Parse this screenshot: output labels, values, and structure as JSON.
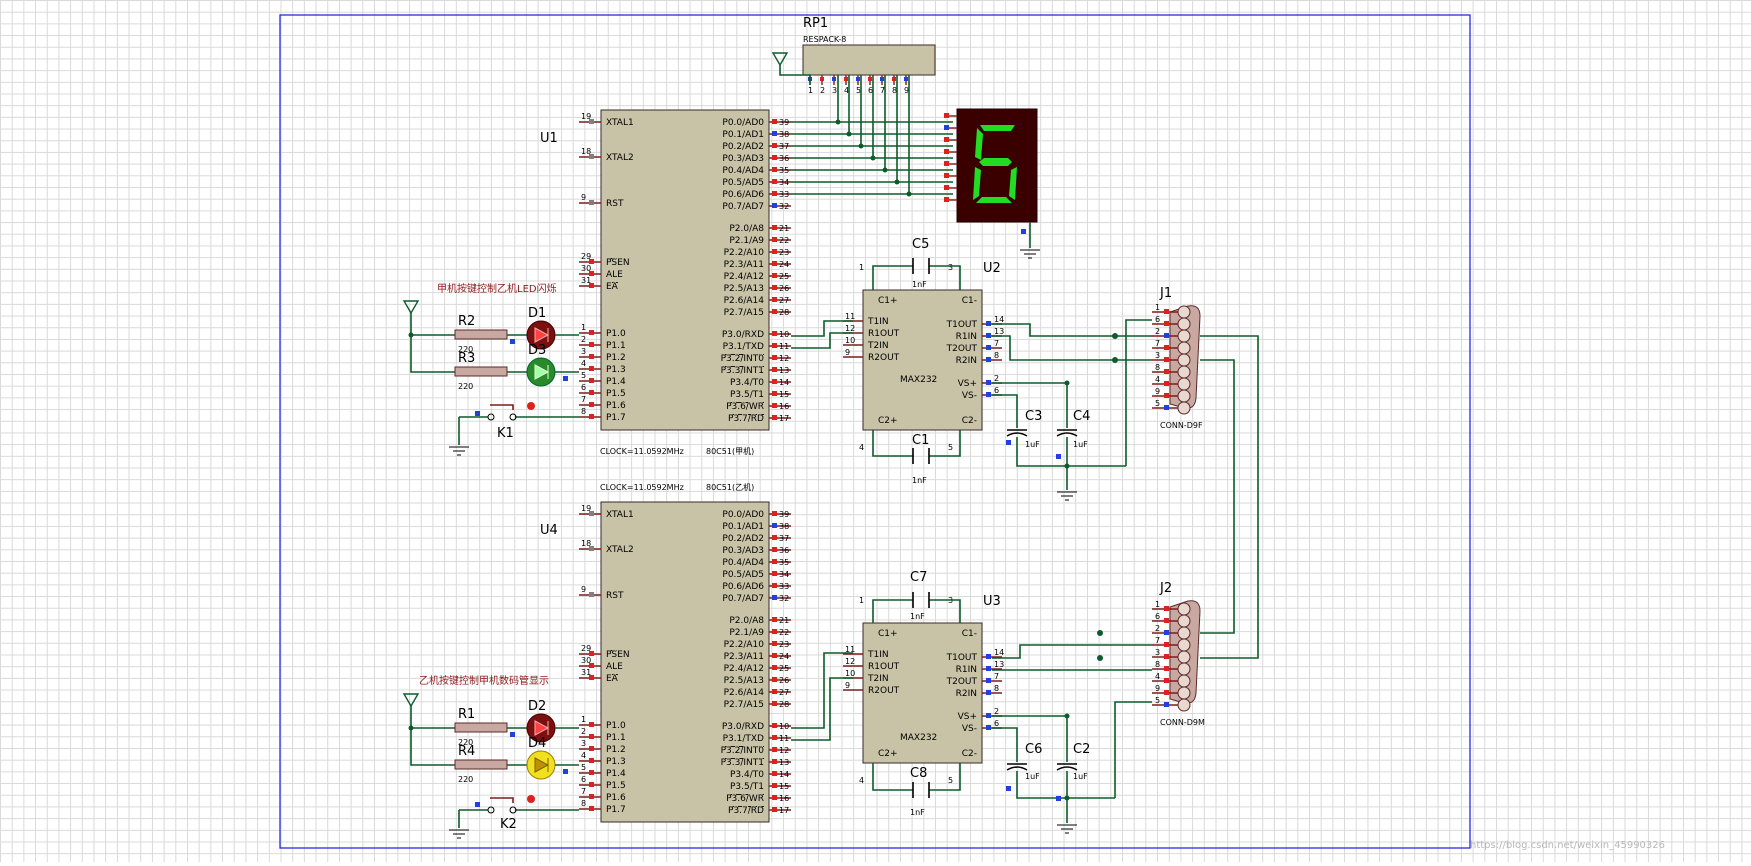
{
  "rp1": {
    "ref": "RP1",
    "value": "RESPACK-8"
  },
  "u1": {
    "ref": "U1",
    "type": "80C51(甲机)",
    "clock": "CLOCK=11.0592MHz"
  },
  "u4": {
    "ref": "U4",
    "type": "80C51(乙机)",
    "clock": "CLOCK=11.0592MHz"
  },
  "u2": {
    "ref": "U2",
    "type": "MAX232"
  },
  "u3": {
    "ref": "U3",
    "type": "MAX232"
  },
  "j1": {
    "ref": "J1",
    "type": "CONN-D9F"
  },
  "j2": {
    "ref": "J2",
    "type": "CONN-D9M"
  },
  "caps": {
    "c5": "C5",
    "c1": "C1",
    "c3": "C3",
    "c4": "C4",
    "c7": "C7",
    "c8": "C8",
    "c6": "C6",
    "c2": "C2",
    "val_1nf": "1nF",
    "val_1uf": "1uF"
  },
  "resistors": {
    "r2": "R2",
    "r3": "R3",
    "r1": "R1",
    "r4": "R4",
    "value": "220"
  },
  "leds": {
    "d1": "D1",
    "d3": "D3",
    "d2": "D2",
    "d4": "D4"
  },
  "keys": {
    "k1": "K1",
    "k2": "K2"
  },
  "notes": {
    "top": "甲机按键控制乙机LED闪烁",
    "bottom": "乙机按键控制甲机数码管显示"
  },
  "mcu_left_pins": [
    {
      "num": "19",
      "name": "XTAL1"
    },
    {
      "num": "18",
      "name": "XTAL2"
    },
    {
      "num": "9",
      "name": "RST"
    },
    {
      "num": "29",
      "name": "PSEN"
    },
    {
      "num": "30",
      "name": "ALE"
    },
    {
      "num": "31",
      "name": "EA"
    },
    {
      "num": "1",
      "name": "P1.0"
    },
    {
      "num": "2",
      "name": "P1.1"
    },
    {
      "num": "3",
      "name": "P1.2"
    },
    {
      "num": "4",
      "name": "P1.3"
    },
    {
      "num": "5",
      "name": "P1.4"
    },
    {
      "num": "6",
      "name": "P1.5"
    },
    {
      "num": "7",
      "name": "P1.6"
    },
    {
      "num": "8",
      "name": "P1.7"
    }
  ],
  "mcu_right_pins": [
    {
      "num": "39",
      "name": "P0.0/AD0"
    },
    {
      "num": "38",
      "name": "P0.1/AD1"
    },
    {
      "num": "37",
      "name": "P0.2/AD2"
    },
    {
      "num": "36",
      "name": "P0.3/AD3"
    },
    {
      "num": "35",
      "name": "P0.4/AD4"
    },
    {
      "num": "34",
      "name": "P0.5/AD5"
    },
    {
      "num": "33",
      "name": "P0.6/AD6"
    },
    {
      "num": "32",
      "name": "P0.7/AD7"
    },
    {
      "num": "21",
      "name": "P2.0/A8"
    },
    {
      "num": "22",
      "name": "P2.1/A9"
    },
    {
      "num": "23",
      "name": "P2.2/A10"
    },
    {
      "num": "24",
      "name": "P2.3/A11"
    },
    {
      "num": "25",
      "name": "P2.4/A12"
    },
    {
      "num": "26",
      "name": "P2.5/A13"
    },
    {
      "num": "27",
      "name": "P2.6/A14"
    },
    {
      "num": "28",
      "name": "P2.7/A15"
    },
    {
      "num": "10",
      "name": "P3.0/RXD"
    },
    {
      "num": "11",
      "name": "P3.1/TXD"
    },
    {
      "num": "12",
      "name": "P3.2/INT0"
    },
    {
      "num": "13",
      "name": "P3.3/INT1"
    },
    {
      "num": "14",
      "name": "P3.4/T0"
    },
    {
      "num": "15",
      "name": "P3.5/T1"
    },
    {
      "num": "16",
      "name": "P3.6/WR"
    },
    {
      "num": "17",
      "name": "P3.7/RD"
    }
  ],
  "max_left_pins": [
    {
      "num": "1",
      "name": "C1+"
    },
    {
      "num": "11",
      "name": "T1IN"
    },
    {
      "num": "12",
      "name": "R1OUT"
    },
    {
      "num": "10",
      "name": "T2IN"
    },
    {
      "num": "9",
      "name": "R2OUT"
    },
    {
      "num": "4",
      "name": "C2+"
    }
  ],
  "max_right_pins": [
    {
      "num": "3",
      "name": "C1-"
    },
    {
      "num": "14",
      "name": "T1OUT"
    },
    {
      "num": "13",
      "name": "R1IN"
    },
    {
      "num": "7",
      "name": "T2OUT"
    },
    {
      "num": "8",
      "name": "R2IN"
    },
    {
      "num": "2",
      "name": "VS+"
    },
    {
      "num": "6",
      "name": "VS-"
    },
    {
      "num": "5",
      "name": "C2-"
    }
  ],
  "db9_pins": [
    "1",
    "6",
    "2",
    "7",
    "3",
    "8",
    "4",
    "9",
    "5"
  ],
  "rp_pins": [
    "1",
    "2",
    "3",
    "4",
    "5",
    "6",
    "7",
    "8",
    "9"
  ],
  "display_digit": "6",
  "colors": {
    "wire": "#0b5c2a",
    "chip": "#c8c3a7",
    "border": "#2a2ae0",
    "segment_on": "#22dd22",
    "note": "#8b1a1a"
  }
}
